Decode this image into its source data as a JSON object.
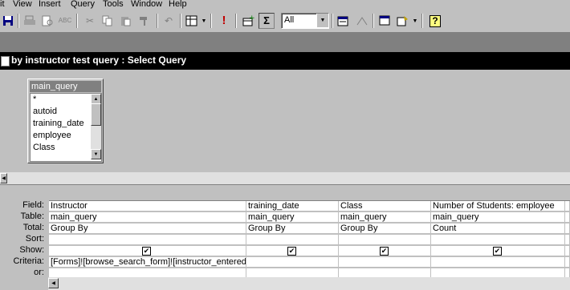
{
  "menu": [
    "it",
    "View",
    "Insert",
    "Query",
    "Tools",
    "Window",
    "Help"
  ],
  "toolbar": {
    "combo_value": "All",
    "icons": [
      "save-icon",
      "print-icon",
      "print-preview-icon",
      "spelling-icon",
      "cut-icon",
      "copy-icon",
      "paste-icon",
      "format-painter-icon",
      "undo-icon",
      "query-type-icon",
      "run-icon",
      "show-table-icon",
      "totals-icon",
      "top-values-combo",
      "properties-icon",
      "build-icon",
      "database-window-icon",
      "new-object-icon",
      "help-icon"
    ],
    "glyphs": {
      "run": "!",
      "totals": "Σ",
      "help": "?"
    }
  },
  "window": {
    "title": "by instructor test query : Select Query"
  },
  "field_list": {
    "table_name": "main_query",
    "items": [
      "*",
      "autoid",
      "training_date",
      "employee",
      "Class"
    ]
  },
  "grid": {
    "row_labels": [
      "Field:",
      "Table:",
      "Total:",
      "Sort:",
      "Show:",
      "Criteria:",
      "or:"
    ],
    "columns": [
      {
        "field": "Instructor",
        "table": "main_query",
        "total": "Group By",
        "sort": "",
        "show": true,
        "criteria": "[Forms]![browse_search_form]![instructor_entered]",
        "or": ""
      },
      {
        "field": "training_date",
        "table": "main_query",
        "total": "Group By",
        "sort": "",
        "show": true,
        "criteria": "",
        "or": ""
      },
      {
        "field": "Class",
        "table": "main_query",
        "total": "Group By",
        "sort": "",
        "show": true,
        "criteria": "",
        "or": ""
      },
      {
        "field": "Number of Students: employee",
        "table": "main_query",
        "total": "Count",
        "sort": "",
        "show": true,
        "criteria": "",
        "or": ""
      }
    ],
    "check_mark": "✔"
  }
}
